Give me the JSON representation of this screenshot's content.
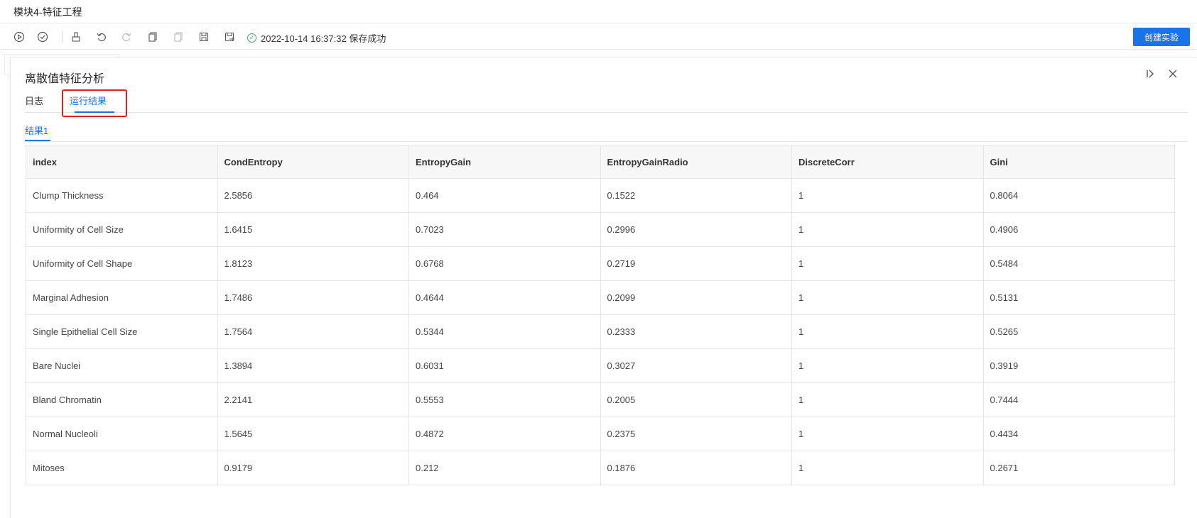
{
  "window": {
    "title": "模块4-特征工程"
  },
  "toolbar": {
    "icons": [
      "run-icon",
      "run-check-icon",
      "clear-icon",
      "undo-icon",
      "redo-icon",
      "copy-icon",
      "paste-icon",
      "save-icon",
      "save-as-icon"
    ],
    "save_status": "2022-10-14 16:37:32 保存成功",
    "create_button": "创建实验"
  },
  "panel": {
    "title": "离散值特征分析",
    "tabs": [
      {
        "label": "日志",
        "active": false
      },
      {
        "label": "运行结果",
        "active": true
      }
    ],
    "subtabs": [
      {
        "label": "结果1",
        "active": true
      }
    ]
  },
  "table": {
    "headers": [
      "index",
      "CondEntropy",
      "EntropyGain",
      "EntropyGainRadio",
      "DiscreteCorr",
      "Gini"
    ],
    "rows": [
      [
        "Clump Thickness",
        "2.5856",
        "0.464",
        "0.1522",
        "1",
        "0.8064"
      ],
      [
        "Uniformity of Cell Size",
        "1.6415",
        "0.7023",
        "0.2996",
        "1",
        "0.4906"
      ],
      [
        "Uniformity of Cell Shape",
        "1.8123",
        "0.6768",
        "0.2719",
        "1",
        "0.5484"
      ],
      [
        "Marginal Adhesion",
        "1.7486",
        "0.4644",
        "0.2099",
        "1",
        "0.5131"
      ],
      [
        "Single Epithelial Cell Size",
        "1.7564",
        "0.5344",
        "0.2333",
        "1",
        "0.5265"
      ],
      [
        "Bare Nuclei",
        "1.3894",
        "0.6031",
        "0.3027",
        "1",
        "0.3919"
      ],
      [
        "Bland Chromatin",
        "2.2141",
        "0.5553",
        "0.2005",
        "1",
        "0.7444"
      ],
      [
        "Normal Nucleoli",
        "1.5645",
        "0.4872",
        "0.2375",
        "1",
        "0.4434"
      ],
      [
        "Mitoses",
        "0.9179",
        "0.212",
        "0.1876",
        "1",
        "0.2671"
      ]
    ]
  },
  "colors": {
    "accent": "#1a73e8",
    "success": "#3aa57a",
    "highlight": "#e02020"
  }
}
